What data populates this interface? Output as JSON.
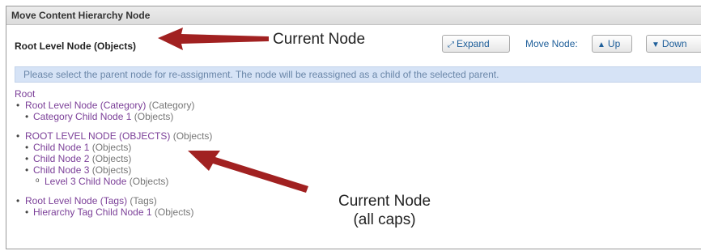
{
  "dialog": {
    "title": "Move Content Hierarchy Node"
  },
  "current_node": "Root Level Node (Objects)",
  "toolbar": {
    "expand_label": "Expand",
    "move_node_label": "Move Node:",
    "up_label": "Up",
    "down_label": "Down"
  },
  "info_message": "Please select the parent node for re-assignment. The node will be reassigned as a child of the selected parent.",
  "tree": {
    "root_label": "Root",
    "nodes": [
      {
        "label": "Root Level Node (Category)",
        "type": "(Category)",
        "children": [
          {
            "label": "Category Child Node 1",
            "type": "(Objects)"
          }
        ]
      },
      {
        "label": "ROOT LEVEL NODE (OBJECTS)",
        "type": "(Objects)",
        "children": [
          {
            "label": "Child Node 1",
            "type": "(Objects)"
          },
          {
            "label": "Child Node 2",
            "type": "(Objects)"
          },
          {
            "label": "Child Node 3",
            "type": "(Objects)",
            "children": [
              {
                "label": "Level 3 Child Node",
                "type": "(Objects)"
              }
            ]
          }
        ]
      },
      {
        "label": "Root Level Node (Tags)",
        "type": "(Tags)",
        "children": [
          {
            "label": "Hierarchy Tag Child Node 1",
            "type": "(Objects)"
          }
        ]
      }
    ]
  },
  "annotations": {
    "top_label": "Current Node",
    "bottom_line1": "Current Node",
    "bottom_line2": "(all caps)"
  },
  "colors": {
    "arrow": "#a12121",
    "link": "#7b3f98",
    "info_bg": "#d6e3f6",
    "button_text": "#1f5f9a"
  }
}
